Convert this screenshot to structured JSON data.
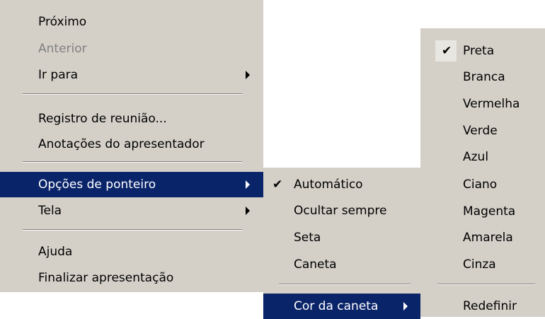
{
  "main_menu": {
    "items": [
      {
        "label": "Próximo"
      },
      {
        "label": "Anterior"
      },
      {
        "label": "Ir para"
      },
      {
        "label": "Registro de reunião..."
      },
      {
        "label": "Anotações do apresentador"
      },
      {
        "label": "Opções de ponteiro"
      },
      {
        "label": "Tela"
      },
      {
        "label": "Ajuda"
      },
      {
        "label": "Finalizar apresentação"
      }
    ]
  },
  "pointer_menu": {
    "items": [
      {
        "label": "Automático"
      },
      {
        "label": "Ocultar sempre"
      },
      {
        "label": "Seta"
      },
      {
        "label": "Caneta"
      },
      {
        "label": "Cor da caneta"
      }
    ]
  },
  "pen_color_menu": {
    "items": [
      {
        "label": "Preta"
      },
      {
        "label": "Branca"
      },
      {
        "label": "Vermelha"
      },
      {
        "label": "Verde"
      },
      {
        "label": "Azul"
      },
      {
        "label": "Ciano"
      },
      {
        "label": "Magenta"
      },
      {
        "label": "Amarela"
      },
      {
        "label": "Cinza"
      },
      {
        "label": "Redefinir"
      }
    ]
  },
  "check_glyph": "✔",
  "colors": {
    "menu_background": "#d4d0c8",
    "highlight": "#0a246a",
    "disabled_text": "#808080"
  }
}
